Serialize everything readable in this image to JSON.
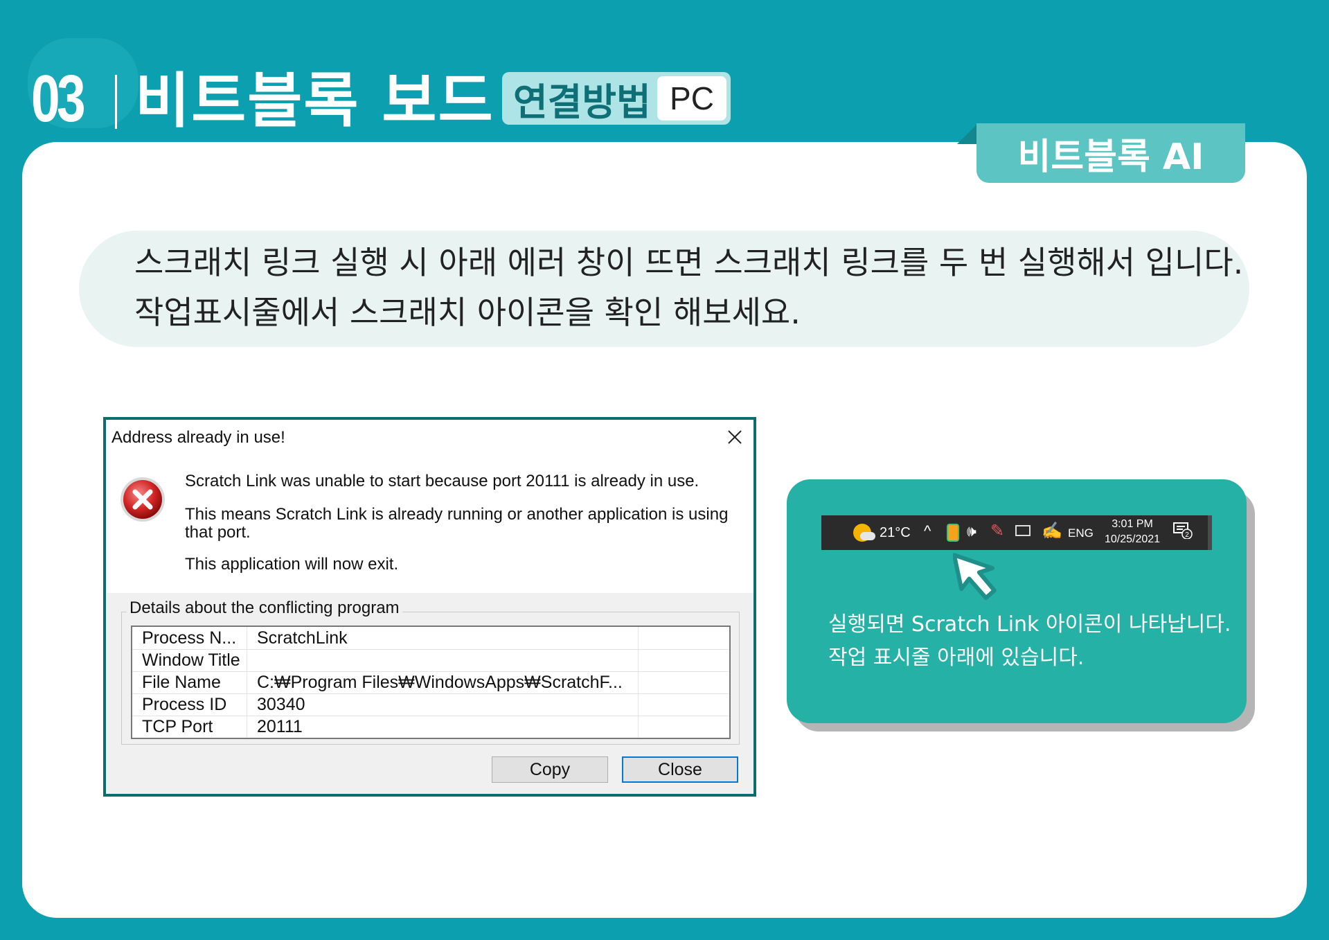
{
  "header": {
    "number": "03",
    "title": "비트블록 보드",
    "tag": "연결방법",
    "platform": "PC",
    "brand": "비트블록 AI"
  },
  "notice": {
    "line1": "스크래치 링크 실행 시 아래 에러 창이 뜨면 스크래치 링크를 두 번 실행해서 입니다.",
    "line2": "작업표시줄에서 스크래치 아이콘을 확인  해보세요."
  },
  "dialog": {
    "title": "Address already in use!",
    "message1": "Scratch Link was unable to start because port 20111 is already in use.",
    "message2": "This means Scratch Link is already running or another application is using that port.",
    "message3": "This application will now exit.",
    "group_label": "Details about the conflicting program",
    "rows": [
      {
        "key": "Process N...",
        "value": "ScratchLink"
      },
      {
        "key": "Window Title",
        "value": ""
      },
      {
        "key": "File Name",
        "value": "C:₩Program Files₩WindowsApps₩ScratchF..."
      },
      {
        "key": "Process ID",
        "value": "30340"
      },
      {
        "key": "TCP Port",
        "value": "20111"
      }
    ],
    "copy_label": "Copy",
    "close_label": "Close"
  },
  "tip": {
    "taskbar": {
      "temperature": "21°C",
      "chevron": "^",
      "volume": "🕪",
      "language": "ENG",
      "time": "3:01 PM",
      "date": "10/25/2021",
      "notification_count": "2"
    },
    "line1": "실행되면 Scratch Link 아이콘이 나타납니다.",
    "line2": "작업 표시줄 아래에 있습니다."
  },
  "colors": {
    "background": "#0c9faf",
    "brand_tab": "#5cc4c3",
    "tip_card": "#26b1a6",
    "dialog_border": "#0d6c6d"
  },
  "icons": [
    "error-icon",
    "close-icon",
    "weather-icon",
    "scratch-link-icon",
    "volume-icon",
    "pen-icon",
    "network-icon",
    "notification-icon",
    "cursor-arrow-icon"
  ]
}
